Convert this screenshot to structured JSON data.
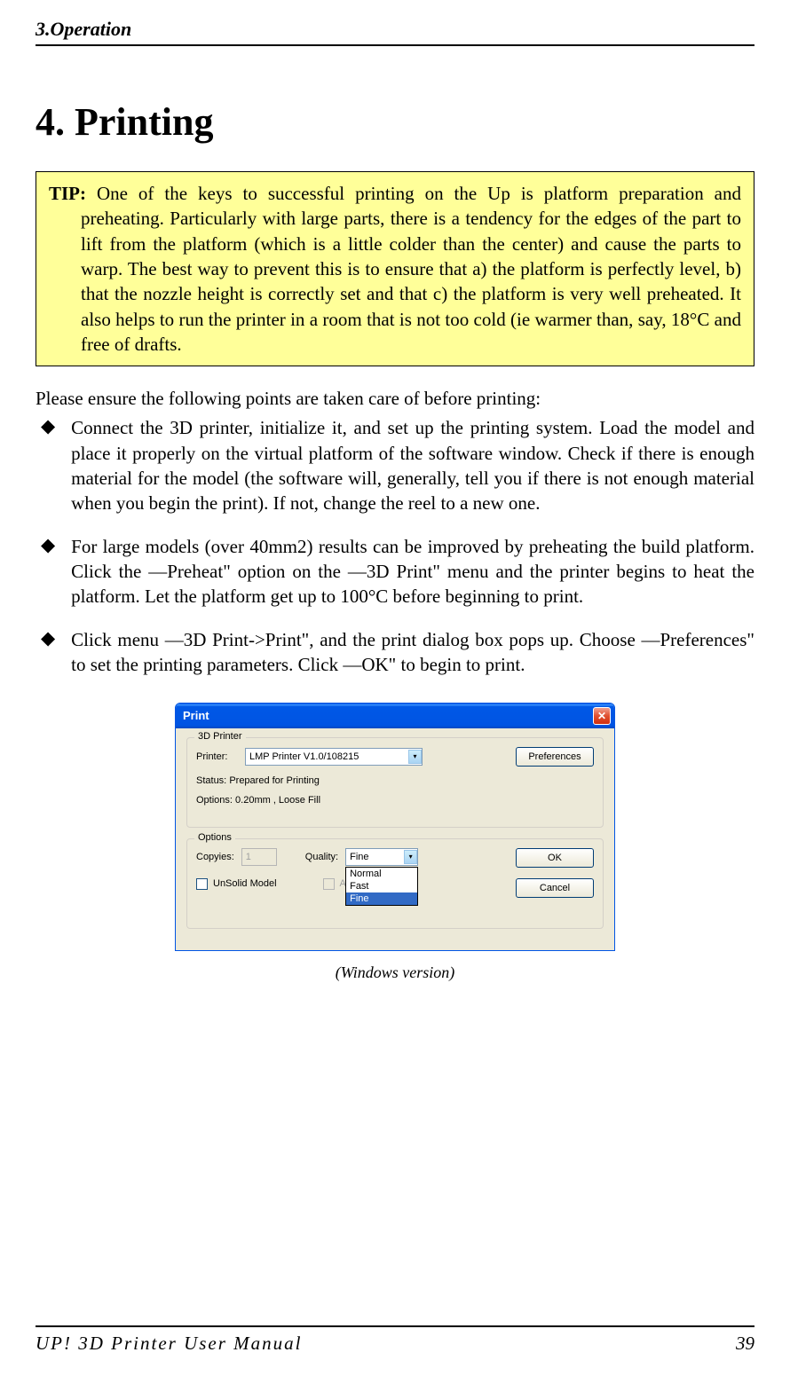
{
  "header": {
    "section_title": "3.Operation"
  },
  "heading": "4. Printing",
  "tip": {
    "label": "TIP:",
    "text": " One of the keys to successful printing on the Up is platform preparation and preheating. Particularly with large parts, there is a tendency for the edges of the part to lift from the platform (which is a little colder than the center) and cause the parts to warp. The best way to prevent this is to ensure that a) the platform is perfectly level, b) that the nozzle height is correctly set and that c) the platform is very well preheated. It also helps to run the printer in a room that is not too cold (ie warmer than, say, 18°C and free of drafts."
  },
  "intro": "Please ensure the following points are taken care of before printing:",
  "bullets": [
    "Connect the 3D printer, initialize it, and set up the printing system. Load the model and place it properly on the virtual platform of the software window. Check if there is enough material for the model (the software will, generally, tell you if there is not enough material when you begin the print). If not, change the reel to a new one.",
    "For large models (over 40mm2) results can be improved by preheating the build platform. Click the ―Preheat\" option on the ―3D Print\" menu and the printer begins to heat the platform. Let the platform get up to 100°C before beginning to print.",
    "Click menu ―3D Print->Print\", and the print dialog box pops up. Choose ―Preferences\" to set the printing parameters. Click ―OK\" to begin to print."
  ],
  "dialog": {
    "title": "Print",
    "group_printer": {
      "legend": "3D Printer",
      "printer_label": "Printer:",
      "printer_value": "LMP Printer V1.0/108215",
      "preferences_button": "Preferences",
      "status_label": "Status:",
      "status_value": "Prepared for Printing",
      "options_label": "Options:",
      "options_value": "0.20mm , Loose Fill"
    },
    "group_options": {
      "legend": "Options",
      "copies_label": "Copyies:",
      "copies_value": "1",
      "quality_label": "Quality:",
      "quality_value": "Fine",
      "quality_options": [
        "Normal",
        "Fast",
        "Fine"
      ],
      "unsolid_label": "UnSolid Model",
      "auto_label": "Auto"
    },
    "ok_button": "OK",
    "cancel_button": "Cancel"
  },
  "caption": "(Windows version)",
  "footer": {
    "left": "UP! 3D Printer User Manual",
    "right": "39"
  }
}
